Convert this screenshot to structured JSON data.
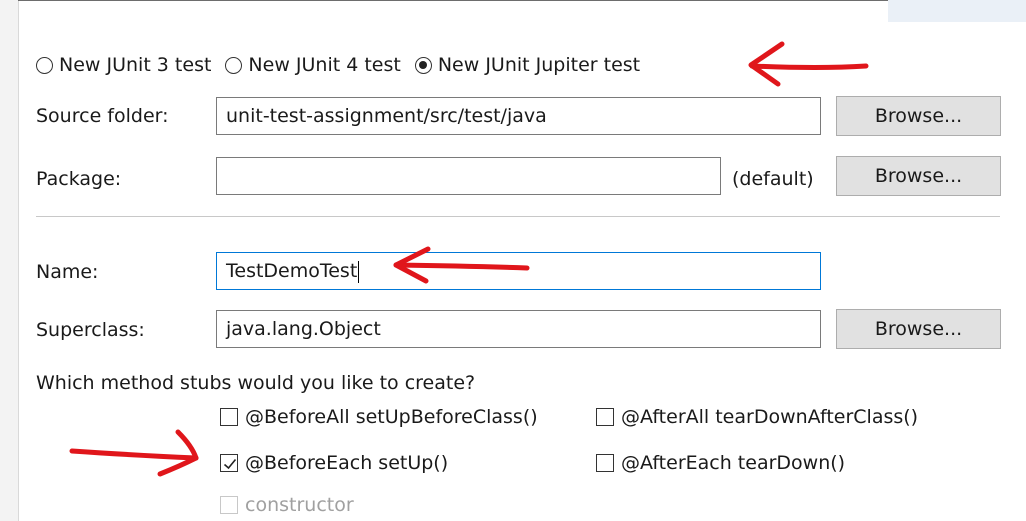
{
  "junit": {
    "options": [
      {
        "label": "New JUnit 3 test",
        "selected": false
      },
      {
        "label": "New JUnit 4 test",
        "selected": false
      },
      {
        "label": "New JUnit Jupiter test",
        "selected": true
      }
    ]
  },
  "source_folder": {
    "label": "Source folder:",
    "value": "unit-test-assignment/src/test/java",
    "browse": "Browse..."
  },
  "package": {
    "label": "Package:",
    "value": "",
    "default_label": "(default)",
    "browse": "Browse..."
  },
  "name": {
    "label": "Name:",
    "value": "TestDemoTest"
  },
  "superclass": {
    "label": "Superclass:",
    "value": "java.lang.Object",
    "browse": "Browse..."
  },
  "stubs": {
    "question": "Which method stubs would you like to create?",
    "before_all": {
      "label": "@BeforeAll setUpBeforeClass()",
      "checked": false
    },
    "after_all": {
      "label": "@AfterAll tearDownAfterClass()",
      "checked": false
    },
    "before_each": {
      "label": "@BeforeEach setUp()",
      "checked": true
    },
    "after_each": {
      "label": "@AfterEach tearDown()",
      "checked": false
    },
    "constructor": {
      "label": "constructor",
      "checked": false,
      "enabled": false
    }
  },
  "colors": {
    "annotation": "#e0161b",
    "focus_border": "#0078d7",
    "button_bg": "#e1e1e1"
  }
}
